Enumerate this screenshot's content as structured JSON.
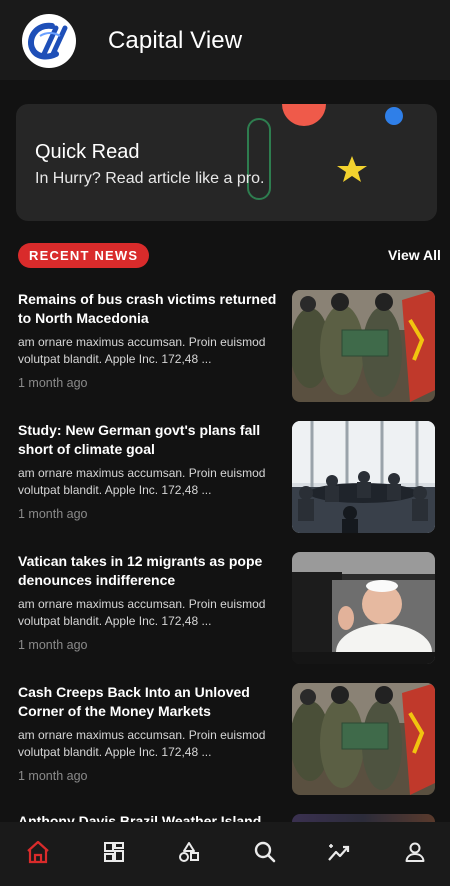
{
  "app": {
    "title": "Capital View",
    "logo_icon": "capital-view-logo"
  },
  "quick_read": {
    "title": "Quick Read",
    "subtitle": "In Hurry? Read article like a pro."
  },
  "section": {
    "label": "RECENT NEWS",
    "view_all": "View All"
  },
  "news": [
    {
      "title": "Remains of bus crash victims returned to North Macedonia",
      "excerpt": "am ornare maximus accumsan. Proin euismod volutpat blandit. Apple Inc. 172,48 ...",
      "time": "1 month ago",
      "image": "soldiers-carrying-coffin"
    },
    {
      "title": "Study: New German govt's plans fall short of climate goal",
      "excerpt": "am ornare maximus accumsan. Proin euismod volutpat blandit. Apple Inc. 172,48 ...",
      "time": "1 month ago",
      "image": "conference-meeting-room"
    },
    {
      "title": "Vatican takes in 12 migrants as pope denounces indifference",
      "excerpt": "am ornare maximus accumsan. Proin euismod volutpat blandit. Apple Inc. 172,48 ...",
      "time": "1 month ago",
      "image": "pope-waving-from-car"
    },
    {
      "title": "Cash Creeps Back Into an Unloved Corner of the Money Markets",
      "excerpt": "am ornare maximus accumsan. Proin euismod volutpat blandit. Apple Inc. 172,48 ...",
      "time": "1 month ago",
      "image": "soldiers-carrying-coffin"
    }
  ],
  "peek_item": {
    "title": "Anthony Davis Brazil Weather Island"
  },
  "bottom_nav": [
    {
      "name": "home",
      "icon": "home-icon",
      "active": true
    },
    {
      "name": "categories",
      "icon": "grid-icon",
      "active": false
    },
    {
      "name": "topics",
      "icon": "shapes-icon",
      "active": false
    },
    {
      "name": "search",
      "icon": "search-icon",
      "active": false
    },
    {
      "name": "trending",
      "icon": "trending-icon",
      "active": false
    },
    {
      "name": "profile",
      "icon": "person-icon",
      "active": false
    }
  ],
  "colors": {
    "accent": "#d92b2b",
    "background": "#121212",
    "bar": "#1a1a1a",
    "card": "#262626",
    "star": "#f2d22e",
    "dot_blue": "#2f7fe8",
    "half_circle": "#ef5a4a"
  }
}
